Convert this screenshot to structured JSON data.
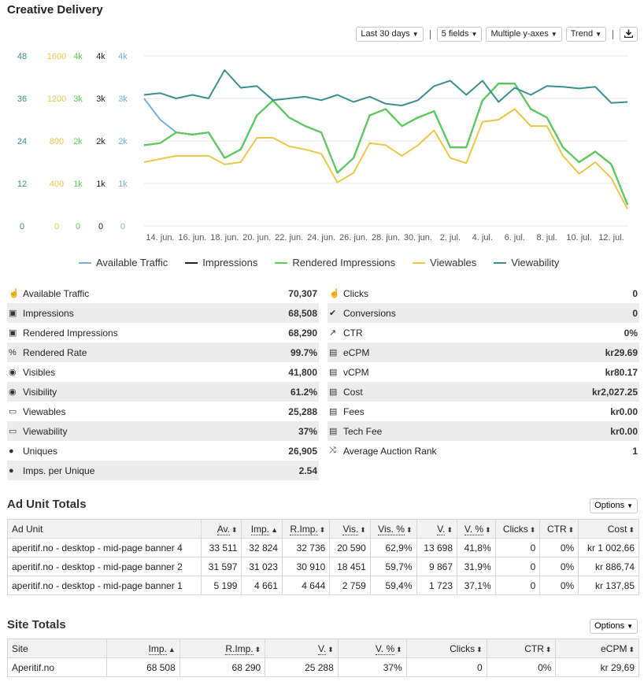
{
  "page_title": "Creative Delivery",
  "toolbar": {
    "range": "Last 30 days",
    "fields": "5 fields",
    "axes": "Multiple y-axes",
    "trend": "Trend",
    "download_icon": "download-icon"
  },
  "chart_data": {
    "type": "line",
    "x": [
      "13. jun.",
      "14. jun.",
      "15. jun.",
      "16. jun.",
      "17. jun.",
      "18. jun.",
      "19. jun.",
      "20. jun.",
      "21. jun.",
      "22. jun.",
      "23. jun.",
      "24. jun.",
      "25. jun.",
      "26. jun.",
      "27. jun.",
      "28. jun.",
      "29. jun.",
      "30. jun.",
      "1. jul.",
      "2. jul.",
      "3. jul.",
      "4. jul.",
      "5. jul.",
      "6. jul.",
      "7. jul.",
      "8. jul.",
      "9. jul.",
      "10. jul.",
      "11. jul.",
      "12. jul.",
      "13. jul."
    ],
    "x_tick_labels": [
      "14. jun.",
      "16. jun.",
      "18. jun.",
      "20. jun.",
      "22. jun.",
      "24. jun.",
      "26. jun.",
      "28. jun.",
      "30. jun.",
      "2. jul.",
      "4. jul.",
      "6. jul.",
      "8. jul.",
      "10. jul.",
      "12. jul."
    ],
    "y_axes": [
      {
        "ticks": [
          "0",
          "12",
          "24",
          "36",
          "48"
        ],
        "color": "#3d8f8f",
        "max": 48,
        "series": "Viewability"
      },
      {
        "ticks": [
          "0",
          "400",
          "800",
          "1200",
          "1600"
        ],
        "color": "#e8c84a",
        "max": 1600,
        "series": "Viewables"
      },
      {
        "ticks": [
          "0",
          "1k",
          "2k",
          "3k",
          "4k"
        ],
        "color": "#5ad05a",
        "max": 4000,
        "series": "Rendered Impressions"
      },
      {
        "ticks": [
          "0",
          "1k",
          "2k",
          "3k",
          "4k"
        ],
        "color": "#222222",
        "max": 4000,
        "series": "Impressions"
      },
      {
        "ticks": [
          "0",
          "1k",
          "2k",
          "3k",
          "4k"
        ],
        "color": "#7aaedc",
        "max": 4000,
        "series": "Available Traffic"
      }
    ],
    "series": [
      {
        "name": "Available Traffic",
        "color": "#7aaedc",
        "axis": "Available Traffic",
        "values": [
          3000,
          2500,
          2200,
          2150,
          2200,
          1600,
          1800,
          2600,
          2950,
          2550,
          2350,
          2200,
          1250,
          1600,
          2600,
          2750,
          2350,
          2550,
          2700,
          1850,
          1850,
          2950,
          3350,
          3350,
          2750,
          2550,
          1850,
          1500,
          1750,
          1450,
          500
        ]
      },
      {
        "name": "Impressions",
        "color": "#222222",
        "axis": "Impressions",
        "values": [
          1900,
          1950,
          2200,
          2150,
          2200,
          1600,
          1800,
          2600,
          2950,
          2550,
          2350,
          2200,
          1250,
          1600,
          2600,
          2750,
          2350,
          2550,
          2700,
          1850,
          1850,
          2950,
          3350,
          3350,
          2750,
          2550,
          1850,
          1500,
          1750,
          1450,
          500
        ]
      },
      {
        "name": "Rendered Impressions",
        "color": "#5ad05a",
        "axis": "Rendered Impressions",
        "values": [
          1900,
          1950,
          2200,
          2150,
          2200,
          1600,
          1800,
          2600,
          2950,
          2550,
          2350,
          2200,
          1250,
          1600,
          2600,
          2750,
          2350,
          2550,
          2700,
          1850,
          1850,
          2950,
          3350,
          3350,
          2750,
          2550,
          1850,
          1500,
          1750,
          1450,
          500
        ]
      },
      {
        "name": "Viewables",
        "color": "#e8c84a",
        "axis": "Viewables",
        "values": [
          600,
          630,
          660,
          660,
          660,
          580,
          600,
          830,
          830,
          750,
          720,
          680,
          410,
          500,
          780,
          760,
          660,
          760,
          900,
          640,
          590,
          980,
          1000,
          1100,
          940,
          940,
          660,
          490,
          600,
          450,
          160
        ]
      },
      {
        "name": "Viewability",
        "color": "#3d8f8f",
        "axis": "Viewability",
        "values": [
          37,
          37.5,
          36,
          37,
          36,
          44,
          39,
          39.5,
          35.5,
          36,
          36.5,
          35.5,
          37,
          35,
          36.5,
          34.5,
          34,
          35.5,
          39.5,
          41,
          37,
          41,
          35,
          39,
          37,
          39.5,
          39.3,
          38.8,
          39.3,
          34.7,
          35
        ]
      }
    ],
    "legend_position": "bottom",
    "grid": true
  },
  "stats_left": [
    {
      "icon": "hand-pointer-icon",
      "glyph": "☝",
      "label": "Available Traffic",
      "value": "70,307"
    },
    {
      "icon": "image-icon",
      "glyph": "▣",
      "label": "Impressions",
      "value": "68,508"
    },
    {
      "icon": "image-icon",
      "glyph": "▣",
      "label": "Rendered Impressions",
      "value": "68,290"
    },
    {
      "icon": "percent-icon",
      "glyph": "%",
      "label": "Rendered Rate",
      "value": "99.7%"
    },
    {
      "icon": "eye-icon",
      "glyph": "◉",
      "label": "Visibles",
      "value": "41,800"
    },
    {
      "icon": "eye-icon",
      "glyph": "◉",
      "label": "Visibility",
      "value": "61.2%"
    },
    {
      "icon": "monitor-icon",
      "glyph": "▭",
      "label": "Viewables",
      "value": "25,288"
    },
    {
      "icon": "monitor-icon",
      "glyph": "▭",
      "label": "Viewability",
      "value": "37%"
    },
    {
      "icon": "user-icon",
      "glyph": "●",
      "label": "Uniques",
      "value": "26,905"
    },
    {
      "icon": "user-icon",
      "glyph": "●",
      "label": "Imps. per Unique",
      "value": "2.54"
    }
  ],
  "stats_right": [
    {
      "icon": "hand-pointer-icon",
      "glyph": "☝",
      "label": "Clicks",
      "value": "0"
    },
    {
      "icon": "check-icon",
      "glyph": "✔",
      "label": "Conversions",
      "value": "0"
    },
    {
      "icon": "line-chart-icon",
      "glyph": "↗",
      "label": "CTR",
      "value": "0%"
    },
    {
      "icon": "money-icon",
      "glyph": "▤",
      "label": "eCPM",
      "value": "kr29.69"
    },
    {
      "icon": "money-icon",
      "glyph": "▤",
      "label": "vCPM",
      "value": "kr80.17"
    },
    {
      "icon": "money-icon",
      "glyph": "▤",
      "label": "Cost",
      "value": "kr2,027.25"
    },
    {
      "icon": "money-icon",
      "glyph": "▤",
      "label": "Fees",
      "value": "kr0.00"
    },
    {
      "icon": "money-icon",
      "glyph": "▤",
      "label": "Tech Fee",
      "value": "kr0.00"
    },
    {
      "icon": "random-icon",
      "glyph": "⤨",
      "label": "Average Auction Rank",
      "value": "1"
    }
  ],
  "ad_unit": {
    "title": "Ad Unit Totals",
    "options": "Options",
    "columns": [
      {
        "label": "Ad Unit",
        "align": "txt",
        "dotted": false,
        "sort": ""
      },
      {
        "label": "Av.",
        "align": "num",
        "dotted": true,
        "sort": "⬍"
      },
      {
        "label": "Imp.",
        "align": "num",
        "dotted": true,
        "sort": "▲"
      },
      {
        "label": "R.Imp.",
        "align": "num",
        "dotted": true,
        "sort": "⬍"
      },
      {
        "label": "Vis.",
        "align": "num",
        "dotted": true,
        "sort": "⬍"
      },
      {
        "label": "Vis. %",
        "align": "num",
        "dotted": true,
        "sort": "⬍"
      },
      {
        "label": "V.",
        "align": "num",
        "dotted": true,
        "sort": "⬍"
      },
      {
        "label": "V. %",
        "align": "num",
        "dotted": true,
        "sort": "⬍"
      },
      {
        "label": "Clicks",
        "align": "num",
        "dotted": false,
        "sort": "⬍"
      },
      {
        "label": "CTR",
        "align": "num",
        "dotted": false,
        "sort": "⬍"
      },
      {
        "label": "Cost",
        "align": "num",
        "dotted": false,
        "sort": "⬍"
      }
    ],
    "rows": [
      [
        "aperitif.no - desktop - mid-page banner 4",
        "33 511",
        "32 824",
        "32 736",
        "20 590",
        "62,9%",
        "13 698",
        "41,8%",
        "0",
        "0%",
        "kr 1 002,66"
      ],
      [
        "aperitif.no - desktop - mid-page banner 2",
        "31 597",
        "31 023",
        "30 910",
        "18 451",
        "59,7%",
        "9 867",
        "31,9%",
        "0",
        "0%",
        "kr 886,74"
      ],
      [
        "aperitif.no - desktop - mid-page banner 1",
        "5 199",
        "4 661",
        "4 644",
        "2 759",
        "59,4%",
        "1 723",
        "37,1%",
        "0",
        "0%",
        "kr 137,85"
      ]
    ]
  },
  "site": {
    "title": "Site Totals",
    "options": "Options",
    "columns": [
      {
        "label": "Site",
        "align": "txt",
        "dotted": false,
        "sort": ""
      },
      {
        "label": "Imp.",
        "align": "num",
        "dotted": true,
        "sort": "▲"
      },
      {
        "label": "R.Imp.",
        "align": "num",
        "dotted": true,
        "sort": "⬍"
      },
      {
        "label": "V.",
        "align": "num",
        "dotted": true,
        "sort": "⬍"
      },
      {
        "label": "V. %",
        "align": "num",
        "dotted": true,
        "sort": "⬍"
      },
      {
        "label": "Clicks",
        "align": "num",
        "dotted": false,
        "sort": "⬍"
      },
      {
        "label": "CTR",
        "align": "num",
        "dotted": false,
        "sort": "⬍"
      },
      {
        "label": "eCPM",
        "align": "num",
        "dotted": false,
        "sort": "⬍"
      }
    ],
    "rows": [
      [
        "Aperitif.no",
        "68 508",
        "68 290",
        "25 288",
        "37%",
        "0",
        "0%",
        "kr 29,69"
      ]
    ]
  }
}
